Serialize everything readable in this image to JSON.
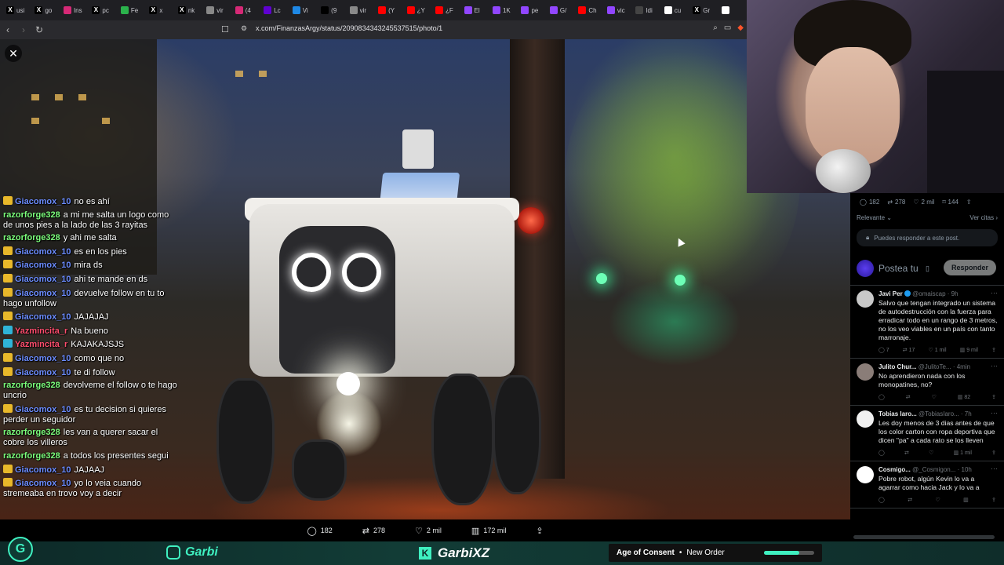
{
  "browser": {
    "tabs": [
      {
        "label": "usi",
        "icon": "x-icon",
        "color": "#000000"
      },
      {
        "label": "go",
        "icon": "x-icon",
        "color": "#000000"
      },
      {
        "label": "Ins",
        "icon": "instagram-icon",
        "color": "#d62976"
      },
      {
        "label": "pc",
        "icon": "x-icon",
        "color": "#000000"
      },
      {
        "label": "Fe",
        "icon": "feedly-icon",
        "color": "#2bb24c"
      },
      {
        "label": "x",
        "icon": "x-icon",
        "color": "#000000"
      },
      {
        "label": "nk",
        "icon": "x-icon",
        "color": "#000000"
      },
      {
        "label": "vir",
        "icon": "globe-icon",
        "color": "#888888"
      },
      {
        "label": "(4",
        "icon": "instagram-icon",
        "color": "#d62976"
      },
      {
        "label": "Lc",
        "icon": "yahoo-icon",
        "color": "#5f01d1"
      },
      {
        "label": "Vi",
        "icon": "globe-icon",
        "color": "#1e88e5"
      },
      {
        "label": "(9",
        "icon": "tiktok-icon",
        "color": "#000000"
      },
      {
        "label": "vir",
        "icon": "globe-icon",
        "color": "#888888"
      },
      {
        "label": "(Y",
        "icon": "youtube-icon",
        "color": "#ff0000"
      },
      {
        "label": "¿Y",
        "icon": "youtube-icon",
        "color": "#ff0000"
      },
      {
        "label": "¿F",
        "icon": "youtube-icon",
        "color": "#ff0000"
      },
      {
        "label": "El",
        "icon": "twitch-icon",
        "color": "#9146ff"
      },
      {
        "label": "1K",
        "icon": "twitch-icon",
        "color": "#9146ff"
      },
      {
        "label": "pe",
        "icon": "twitch-icon",
        "color": "#9146ff"
      },
      {
        "label": "G/",
        "icon": "twitch-icon",
        "color": "#9146ff"
      },
      {
        "label": "Ch",
        "icon": "youtube-icon",
        "color": "#ff0000"
      },
      {
        "label": "vic",
        "icon": "twitch-icon",
        "color": "#9146ff"
      },
      {
        "label": "Idi",
        "icon": "app-icon",
        "color": "#444444"
      },
      {
        "label": "cu",
        "icon": "google-icon",
        "color": "#ffffff"
      },
      {
        "label": "Gr",
        "icon": "x-icon",
        "color": "#000000"
      },
      {
        "label": "",
        "icon": "google-icon",
        "color": "#ffffff"
      }
    ],
    "url": "x.com/FinanzasArgy/status/2090834343245537515/photo/1"
  },
  "chat": [
    {
      "user": "Giacomox_10",
      "color": "#6b8cff",
      "badge": "gold",
      "text": "no es ahí"
    },
    {
      "user": "razorforge328",
      "color": "#7cff7c",
      "badge": "",
      "text": "a mi me salta un logo como de unos pies a la lado de las 3 rayitas"
    },
    {
      "user": "razorforge328",
      "color": "#7cff7c",
      "badge": "",
      "text": "y ahi me salta"
    },
    {
      "user": "Giacomox_10",
      "color": "#6b8cff",
      "badge": "gold",
      "text": "es en los pies"
    },
    {
      "user": "Giacomox_10",
      "color": "#6b8cff",
      "badge": "gold",
      "text": "mira ds"
    },
    {
      "user": "Giacomox_10",
      "color": "#6b8cff",
      "badge": "gold",
      "text": "ahi te mande en ds"
    },
    {
      "user": "Giacomox_10",
      "color": "#6b8cff",
      "badge": "gold",
      "text": "devuelve follow en tu to hago unfollow"
    },
    {
      "user": "Giacomox_10",
      "color": "#6b8cff",
      "badge": "gold",
      "text": "JAJAJAJ"
    },
    {
      "user": "Yazmincita_r",
      "color": "#ff4d6d",
      "badge": "teal",
      "text": "Na bueno"
    },
    {
      "user": "Yazmincita_r",
      "color": "#ff4d6d",
      "badge": "teal",
      "text": "KAJAKAJSJS"
    },
    {
      "user": "Giacomox_10",
      "color": "#6b8cff",
      "badge": "gold",
      "text": "como que no"
    },
    {
      "user": "Giacomox_10",
      "color": "#6b8cff",
      "badge": "gold",
      "text": "te di follow"
    },
    {
      "user": "razorforge328",
      "color": "#7cff7c",
      "badge": "",
      "text": "devolveme el follow o te hago uncrio"
    },
    {
      "user": "Giacomox_10",
      "color": "#6b8cff",
      "badge": "gold",
      "text": "es tu decision si quieres perder un seguidor"
    },
    {
      "user": "razorforge328",
      "color": "#7cff7c",
      "badge": "",
      "text": "les van a querer sacar el cobre los villeros"
    },
    {
      "user": "razorforge328",
      "color": "#7cff7c",
      "badge": "",
      "text": "a todos los presentes segui"
    },
    {
      "user": "Giacomox_10",
      "color": "#6b8cff",
      "badge": "gold",
      "text": "JAJAAJ"
    },
    {
      "user": "Giacomox_10",
      "color": "#6b8cff",
      "badge": "gold",
      "text": "yo lo veia cuando stremeaba en trovo voy a decir"
    }
  ],
  "photo_actions": {
    "replies": "182",
    "reposts": "278",
    "likes": "2 mil",
    "views": "172 mil"
  },
  "stream": {
    "instagram_handle": "Garbi",
    "kick_name": "GarbiXZ",
    "now_playing": {
      "artist": "Age of Consent",
      "separator": "•",
      "title": "New Order",
      "progress": 0.7
    }
  },
  "sidebar": {
    "stats": {
      "replies": "182",
      "reposts": "278",
      "likes": "2 mil",
      "bookmarks": "144"
    },
    "sort_label": "Relevante",
    "quotes_label": "Ver citas",
    "restricted_text": "Puedes responder a este post.",
    "reply_placeholder": "Postea tu",
    "reply_button": "Responder",
    "tweets": [
      {
        "name": "Javi Per",
        "handle": "@omaiscap · 9h",
        "verified": true,
        "text": "Salvo que tengan integrado un sistema de autodestrucción con la fuerza para erradicar todo en un rango de 3 metros, no los veo viables en un país con tanto marronaje.",
        "replies": "7",
        "reposts": "17",
        "likes": "1 mil",
        "views": "9 mil",
        "avatar_color": "#c9c9c9"
      },
      {
        "name": "Julito Chur...",
        "handle": "@JulitoTe... · 4min",
        "verified": false,
        "text": "No aprendieron nada con los monopatines, no?",
        "replies": "",
        "reposts": "",
        "likes": "",
        "views": "82",
        "avatar_color": "#8a7d78"
      },
      {
        "name": "Tobias Iaro...",
        "handle": "@TobiasIaro... · 7h",
        "verified": false,
        "text": "Les doy menos de 3 dias antes de que los color carton con ropa deportiva que dicen \"pa\" a cada rato se los lleven",
        "replies": "",
        "reposts": "",
        "likes": "",
        "views": "1 mil",
        "avatar_color": "#f0f0f0"
      },
      {
        "name": "Cosmigo...",
        "handle": "@_Cosmigon... · 10h",
        "verified": false,
        "text": "Pobre robot, algún Kevin lo va a agarrar como hacia Jack y lo va a",
        "replies": "",
        "reposts": "",
        "likes": "",
        "views": "",
        "avatar_color": "#ffffff"
      }
    ]
  }
}
